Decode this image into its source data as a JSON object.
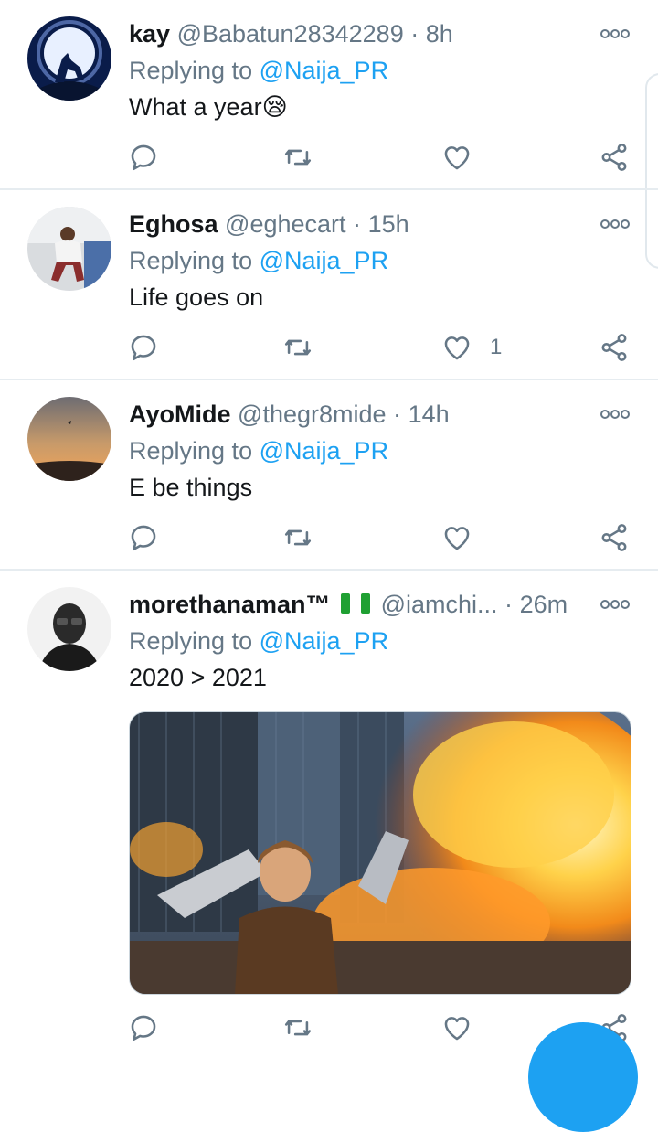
{
  "tweets": [
    {
      "name": "kay",
      "handle": "@Babatun28342289",
      "dot": "·",
      "time": "8h",
      "replying_prefix": "Replying to",
      "replying_to": "@Naija_PR",
      "text": "What a year",
      "emoji": "😪",
      "likes": ""
    },
    {
      "name": "Eghosa",
      "handle": "@eghecart",
      "dot": "·",
      "time": "15h",
      "replying_prefix": "Replying to",
      "replying_to": "@Naija_PR",
      "text": "Life goes on",
      "likes": "1"
    },
    {
      "name": "AyoMide",
      "handle": "@thegr8mide",
      "dot": "·",
      "time": "14h",
      "replying_prefix": "Replying to",
      "replying_to": "@Naija_PR",
      "text": "E be things",
      "likes": ""
    },
    {
      "name": "morethanaman™",
      "handle": "@iamchi...",
      "dot": "·",
      "time": "26m",
      "replying_prefix": "Replying to",
      "replying_to": "@Naija_PR",
      "text": "2020 > 2021",
      "likes": ""
    }
  ],
  "icons": {
    "reply": "reply-icon",
    "retweet": "retweet-icon",
    "like": "heart-icon",
    "share": "share-icon",
    "more": "more-options-icon",
    "flag": "nigeria-flag-icon"
  },
  "colors": {
    "link": "#1da1f2",
    "secondary": "#657786",
    "divider": "#e6ecf0",
    "flag_green": "#1fa032"
  }
}
